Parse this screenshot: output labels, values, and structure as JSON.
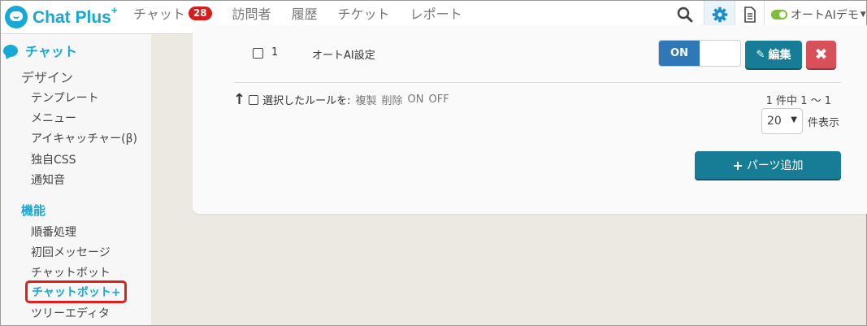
{
  "app": {
    "brand": "Chat Plus",
    "brand_sup": "+",
    "accent_color": "#17a9d6"
  },
  "nav": {
    "chat": "チャット",
    "chat_badge": "28",
    "visitors": "訪問者",
    "history": "履歴",
    "tickets": "チケット",
    "reports": "レポート"
  },
  "toolbar": {
    "icons": [
      "search-icon",
      "gear-icon",
      "document-icon"
    ],
    "status_label": "オートAIデモ"
  },
  "sidebar": {
    "header": "チャット",
    "design_category": "デザイン",
    "design_items": [
      "テンプレート",
      "メニュー",
      "アイキャッチャー(β)",
      "独自CSS",
      "通知音"
    ],
    "feature_category": "機能",
    "feature_items": [
      "順番処理",
      "初回メッセージ",
      "チャットボット",
      "チャットボット+",
      "ツリーエディタ"
    ]
  },
  "rule_row": {
    "number": "1",
    "name": "オートAI設定",
    "toggle": "ON",
    "edit_label": "編集",
    "delete_label": "✖"
  },
  "bulk": {
    "label": "選択したルールを:",
    "duplicate": "複製",
    "delete": "削除",
    "on": "ON",
    "off": "OFF"
  },
  "pagination": {
    "count_text": "1 件中 1 ～ 1",
    "per_page_value": "20",
    "per_page_suffix": "件表示"
  },
  "add_parts_label": "パーツ追加"
}
